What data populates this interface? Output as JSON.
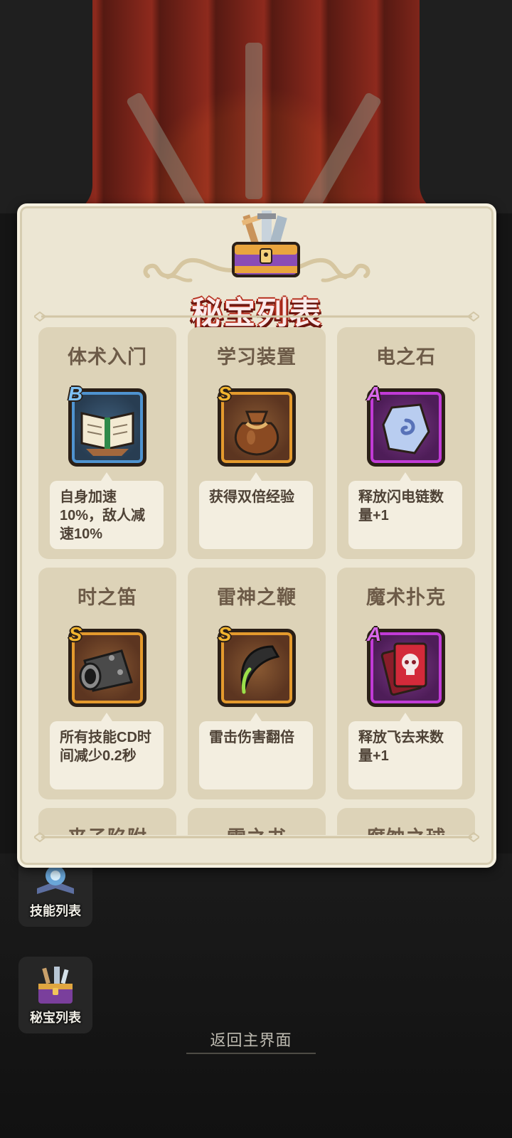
{
  "panel": {
    "title": "秘宝列表"
  },
  "items": [
    {
      "name": "体术入门",
      "rank": "B",
      "icon": "open-book-icon",
      "desc": "自身加速10%，敌人减速10%"
    },
    {
      "name": "学习装置",
      "rank": "S",
      "icon": "loot-bag-icon",
      "desc": "获得双倍经验"
    },
    {
      "name": "电之石",
      "rank": "A",
      "icon": "rune-stone-icon",
      "desc": "释放闪电链数量+1"
    },
    {
      "name": "时之笛",
      "rank": "S",
      "icon": "iron-flute-icon",
      "desc": "所有技能CD时间减少0.2秒"
    },
    {
      "name": "雷神之鞭",
      "rank": "S",
      "icon": "horn-whip-icon",
      "desc": "雷击伤害翻倍"
    },
    {
      "name": "魔术扑克",
      "rank": "A",
      "icon": "skull-card-icon",
      "desc": "释放飞去来数量+1"
    },
    {
      "name": "来子陷附",
      "rank": "",
      "icon": "",
      "desc": ""
    },
    {
      "name": "雷之书",
      "rank": "",
      "icon": "",
      "desc": ""
    },
    {
      "name": "腐蚀之球",
      "rank": "",
      "icon": "",
      "desc": ""
    }
  ],
  "side_menu": {
    "skill_list": "技能列表",
    "treasure_list": "秘宝列表"
  },
  "footer": {
    "return_label": "返回主界面"
  },
  "colors": {
    "panel_bg": "#ece6d3",
    "card_bg": "#ddd3b8",
    "rank_S": "#e49a2d",
    "rank_A": "#c13bd6",
    "rank_B": "#4f93d0",
    "title_red": "#b6311f"
  }
}
